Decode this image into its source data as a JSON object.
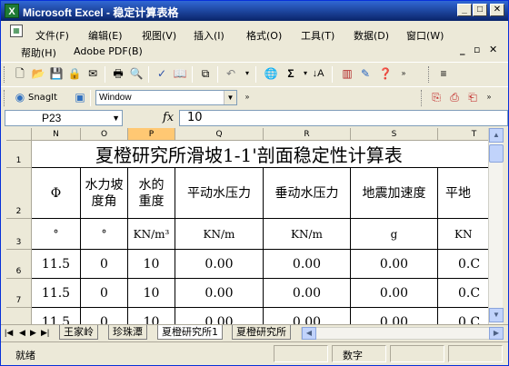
{
  "window": {
    "title": "Microsoft Excel - 稳定计算表格",
    "app_icon": "excel-icon",
    "controls": [
      "minimize-icon",
      "maximize-icon",
      "close-icon"
    ]
  },
  "menu": {
    "items": [
      "文件(F)",
      "编辑(E)",
      "视图(V)",
      "插入(I)",
      "格式(O)",
      "工具(T)",
      "数据(D)",
      "窗口(W)",
      "帮助(H)",
      "Adobe PDF(B)"
    ],
    "mdi_controls": [
      "_",
      "▫",
      "✕"
    ]
  },
  "toolbar2": {
    "snagit_label": "SnagIt",
    "window_combo": "Window"
  },
  "formula_bar": {
    "name_box": "P23",
    "fx_label": "fx",
    "value": "10"
  },
  "grid": {
    "columns": [
      "N",
      "O",
      "P",
      "Q",
      "R",
      "S",
      "T"
    ],
    "selected_column": "P",
    "rows": [
      "1",
      "2",
      "3",
      "6",
      "7",
      "8"
    ],
    "title": "夏橙研究所滑坡1-1'剖面稳定性计算表",
    "headers": [
      "Φ",
      "水力坡度角",
      "水的重度",
      "平动水压力",
      "垂动水压力",
      "地震加速度",
      "平地"
    ],
    "units": [
      "°",
      "°",
      "KN/m³",
      "KN/m",
      "KN/m",
      "g",
      "KN"
    ],
    "data_rows": [
      [
        "11.5",
        "0",
        "10",
        "0.00",
        "0.00",
        "0.00",
        "0.C"
      ],
      [
        "11.5",
        "0",
        "10",
        "0.00",
        "0.00",
        "0.00",
        "0.C"
      ],
      [
        "11.5",
        "0",
        "10",
        "0.00",
        "0.00",
        "0.00",
        "0.C"
      ]
    ]
  },
  "sheet_tabs": {
    "tabs": [
      "王家岭",
      "珍珠潭",
      "夏橙研究所1",
      "夏橙研究所"
    ],
    "active": "夏橙研究所1"
  },
  "status": {
    "ready": "就绪",
    "num": "数字"
  }
}
